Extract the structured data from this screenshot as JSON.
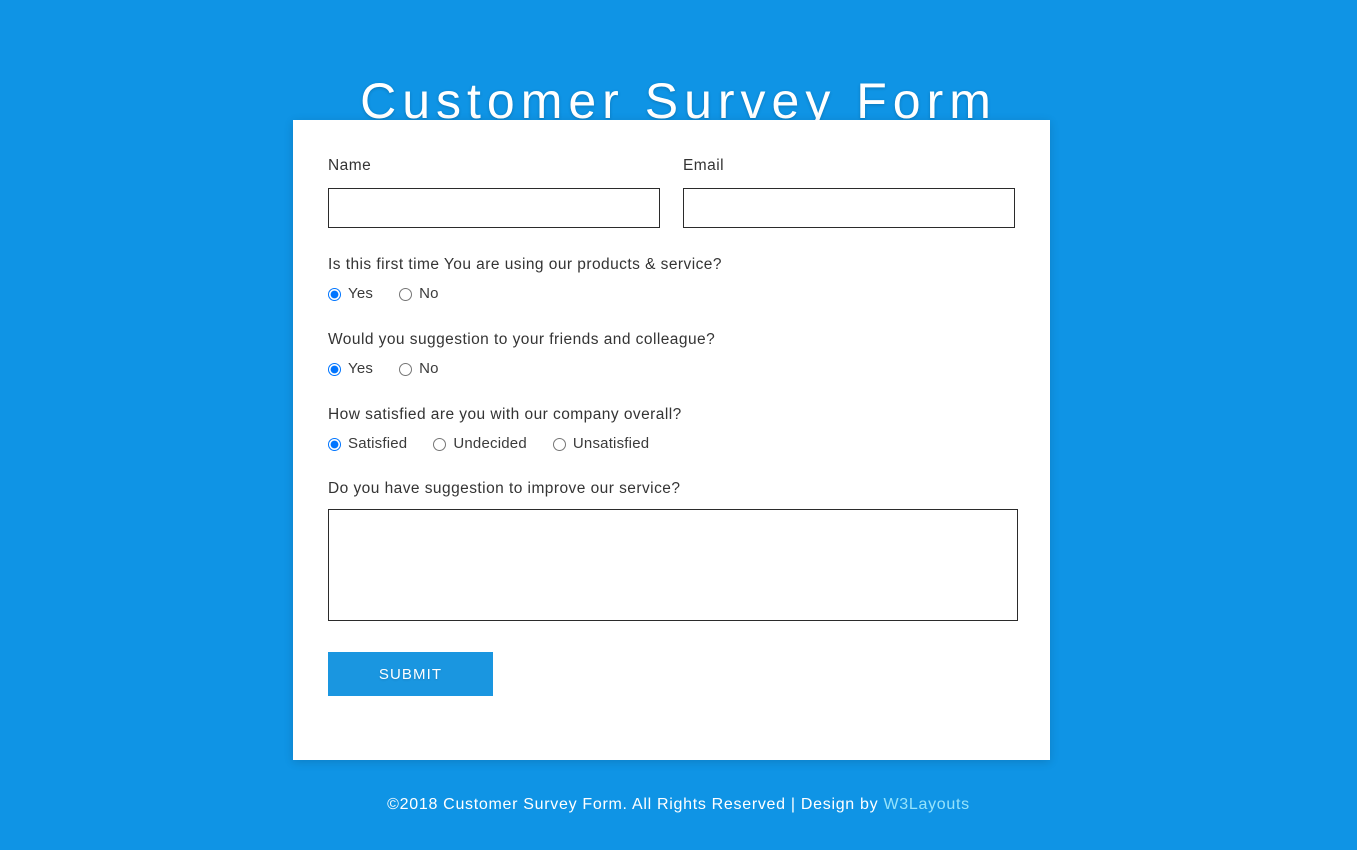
{
  "page": {
    "title": "Customer Survey Form",
    "background_color": "#0f94e5",
    "card_background": "#ffffff",
    "accent_color": "#1a96e0",
    "text_color": "#343434",
    "footer_link_color": "#96e3fb"
  },
  "form": {
    "name_field": {
      "label": "Name",
      "value": "",
      "placeholder": ""
    },
    "email_field": {
      "label": "Email",
      "value": "",
      "placeholder": ""
    },
    "questions": [
      {
        "text": "Is this first time You are using our products & service?",
        "options": [
          {
            "label": "Yes",
            "selected": true
          },
          {
            "label": "No",
            "selected": false
          }
        ]
      },
      {
        "text": "Would you suggestion to your friends and colleague?",
        "options": [
          {
            "label": "Yes",
            "selected": true
          },
          {
            "label": "No",
            "selected": false
          }
        ]
      },
      {
        "text": "How satisfied are you with our company overall?",
        "options": [
          {
            "label": "Satisfied",
            "selected": true
          },
          {
            "label": "Undecided",
            "selected": false
          },
          {
            "label": "Unsatisfied",
            "selected": false
          }
        ]
      }
    ],
    "suggestion": {
      "label": "Do you have suggestion to improve our service?",
      "value": "",
      "placeholder": ""
    },
    "submit_label": "SUBMIT"
  },
  "footer": {
    "text": "©2018 Customer Survey Form. All Rights Reserved | Design by ",
    "brand": "W3Layouts"
  }
}
